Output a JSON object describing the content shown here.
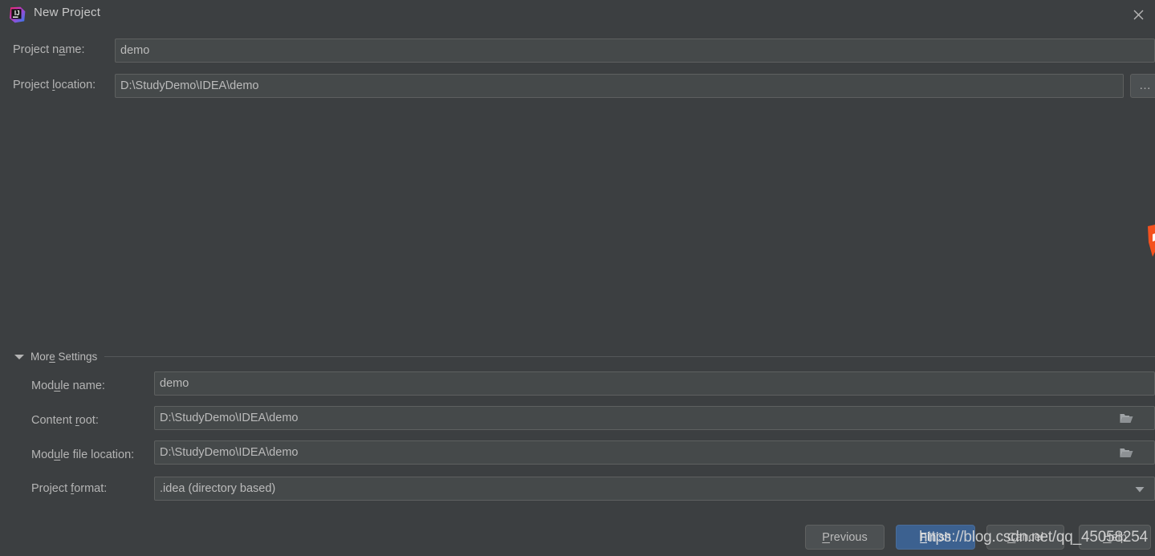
{
  "window": {
    "title": "New Project",
    "app_icon": "intellij-idea-icon",
    "close_label": "✕"
  },
  "main_form": {
    "fields": [
      {
        "id": "project-name",
        "label_before": "Project n",
        "label_mnemonic": "a",
        "label_after": "me:",
        "value": "demo",
        "icon": null
      },
      {
        "id": "project-location",
        "label_before": "Project ",
        "label_mnemonic": "l",
        "label_after": "ocation:",
        "value": "D:\\StudyDemo\\IDEA\\demo",
        "icon": null
      }
    ],
    "browse_button": {
      "label": "…",
      "icon": "ellipsis-icon"
    }
  },
  "more_settings": {
    "label_before": "Mor",
    "label_mnemonic": "e",
    "label_after": " Settings",
    "expanded": true,
    "toggle_icon": "triangle-down-icon",
    "fields": [
      {
        "id": "module-name",
        "label_before": "Mod",
        "label_mnemonic": "u",
        "label_after": "le name:",
        "value": "demo",
        "icon": null
      },
      {
        "id": "content-root",
        "label_before": "Content ",
        "label_mnemonic": "r",
        "label_after": "oot:",
        "value": "D:\\StudyDemo\\IDEA\\demo",
        "icon": "folder-icon"
      },
      {
        "id": "module-file-location",
        "label_before": "Mod",
        "label_mnemonic": "u",
        "label_after": "le file location:",
        "value": "D:\\StudyDemo\\IDEA\\demo",
        "icon": "folder-icon"
      },
      {
        "id": "project-format",
        "label_before": "Project ",
        "label_mnemonic": "f",
        "label_after": "ormat:",
        "value": ".idea (directory based)",
        "icon": "chevron-down-icon",
        "options": [
          ".idea (directory based)"
        ]
      }
    ]
  },
  "footer": {
    "buttons": [
      {
        "id": "previous",
        "before": "",
        "mnemonic": "P",
        "after": "revious",
        "primary": false
      },
      {
        "id": "finish",
        "before": "",
        "mnemonic": "F",
        "after": "inish",
        "primary": true
      },
      {
        "id": "cancel",
        "before": "",
        "mnemonic": "C",
        "after": "ancel",
        "primary": false
      },
      {
        "id": "help",
        "before": "",
        "mnemonic": "H",
        "after": "elp",
        "primary": false
      }
    ]
  },
  "overlay": {
    "watermark": "https://blog.csdn.net/qq_45058254"
  },
  "colors": {
    "window_bg": "#3c3f41",
    "field_bg": "#45494a",
    "field_border": "#5e6060",
    "button_bg": "#4c5052",
    "primary_button_bg": "#3c6190",
    "text": "#bbbbbb",
    "accent_orange": "#f4511e"
  }
}
